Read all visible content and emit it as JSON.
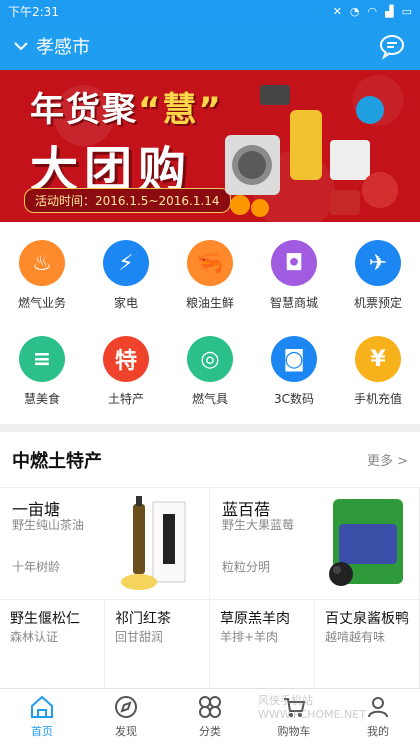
{
  "status": {
    "time": "下午2:31"
  },
  "header": {
    "city": "孝感市"
  },
  "banner": {
    "title_part1": "年货聚",
    "title_highlight": "“慧”",
    "title2": "大团购",
    "date": "活动时间：2016.1.5~2016.1.14"
  },
  "services": [
    {
      "label": "燃气业务",
      "color": "#ff8a2b",
      "icon": "flame-icon",
      "glyph": "♨"
    },
    {
      "label": "家电",
      "color": "#1c86f2",
      "icon": "plug-icon",
      "glyph": "⚡"
    },
    {
      "label": "粮油生鲜",
      "color": "#ff8a2b",
      "icon": "shrimp-icon",
      "glyph": "🦐"
    },
    {
      "label": "智慧商城",
      "color": "#a05be0",
      "icon": "shopping-bag-icon",
      "glyph": "◘"
    },
    {
      "label": "机票预定",
      "color": "#1c86f2",
      "icon": "airplane-icon",
      "glyph": "✈"
    },
    {
      "label": "慧美食",
      "color": "#2bbf8a",
      "icon": "burger-icon",
      "glyph": "≡"
    },
    {
      "label": "土特产",
      "color": "#f0432b",
      "icon": "specialty-icon",
      "glyph": "特"
    },
    {
      "label": "燃气具",
      "color": "#2bbf8a",
      "icon": "stove-icon",
      "glyph": "◎"
    },
    {
      "label": "3C数码",
      "color": "#1c86f2",
      "icon": "camera-icon",
      "glyph": "◙"
    },
    {
      "label": "手机充值",
      "color": "#f7b21b",
      "icon": "phone-recharge-icon",
      "glyph": "¥"
    }
  ],
  "section": {
    "title": "中燃土特产",
    "more": "更多 >"
  },
  "products": [
    {
      "name": "一亩塘",
      "desc": "野生纯山茶油",
      "sub": "十年树龄"
    },
    {
      "name": "蓝百蓓",
      "desc": "野生大果蓝莓",
      "sub": "粒粒分明"
    }
  ],
  "small_products": [
    {
      "name": "野生偃松仁",
      "desc": "森林认证"
    },
    {
      "name": "祁门红茶",
      "desc": "回甘甜润"
    },
    {
      "name": "草原羔羊肉",
      "desc": "羊排+羊肉"
    },
    {
      "name": "百丈泉酱板鸭",
      "desc": "越啃越有味"
    }
  ],
  "tabs": [
    {
      "label": "首页",
      "active": true
    },
    {
      "label": "发现",
      "active": false
    },
    {
      "label": "分类",
      "active": false
    },
    {
      "label": "购物车",
      "active": false
    },
    {
      "label": "我的",
      "active": false
    }
  ],
  "watermark": "风侠手机站 WWW.PCHOME.NET"
}
